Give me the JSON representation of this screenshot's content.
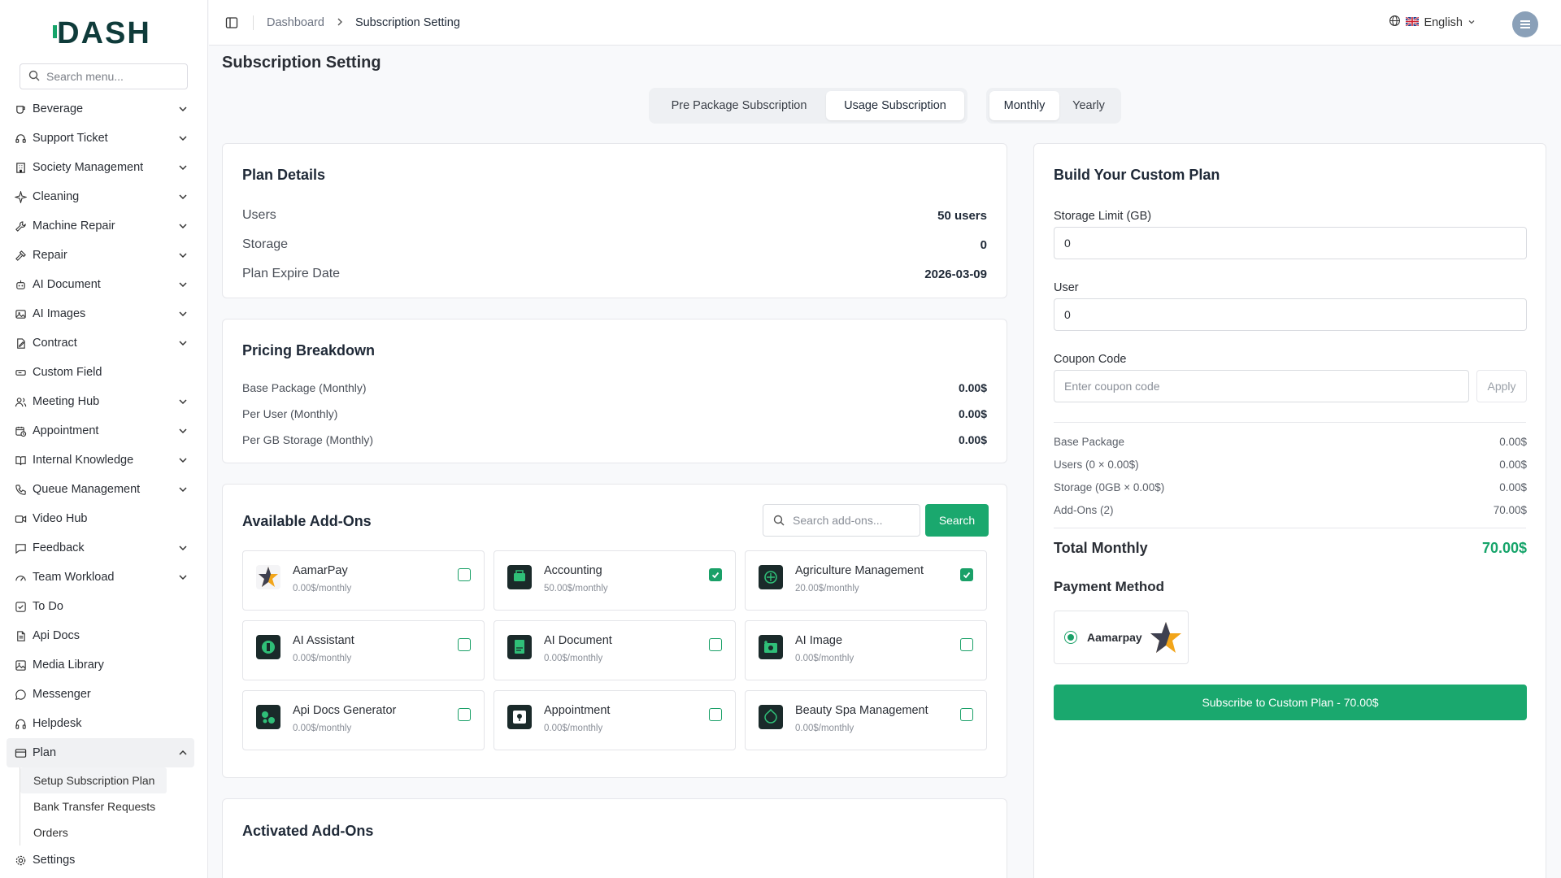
{
  "brand": {
    "logo_text": "DASH"
  },
  "sidebar": {
    "search_placeholder": "Search menu...",
    "items": [
      {
        "label": "Beverage",
        "icon": "cup-icon",
        "expandable": true
      },
      {
        "label": "Support Ticket",
        "icon": "headset-icon",
        "expandable": true
      },
      {
        "label": "Society Management",
        "icon": "building-icon",
        "expandable": true
      },
      {
        "label": "Cleaning",
        "icon": "sparkle-icon",
        "expandable": true
      },
      {
        "label": "Machine Repair",
        "icon": "wrench-icon",
        "expandable": true
      },
      {
        "label": "Repair",
        "icon": "hammer-icon",
        "expandable": true
      },
      {
        "label": "AI Document",
        "icon": "robot-icon",
        "expandable": true
      },
      {
        "label": "AI Images",
        "icon": "image-icon",
        "expandable": true
      },
      {
        "label": "Contract",
        "icon": "contract-icon",
        "expandable": true
      },
      {
        "label": "Custom Field",
        "icon": "field-icon",
        "expandable": false
      },
      {
        "label": "Meeting Hub",
        "icon": "users-icon",
        "expandable": true
      },
      {
        "label": "Appointment",
        "icon": "calendar-clock-icon",
        "expandable": true
      },
      {
        "label": "Internal Knowledge",
        "icon": "book-icon",
        "expandable": true
      },
      {
        "label": "Queue Management",
        "icon": "phone-icon",
        "expandable": true
      },
      {
        "label": "Video Hub",
        "icon": "video-icon",
        "expandable": false
      },
      {
        "label": "Feedback",
        "icon": "message-square-icon",
        "expandable": true
      },
      {
        "label": "Team Workload",
        "icon": "gauge-icon",
        "expandable": true
      },
      {
        "label": "To Do",
        "icon": "checkbox-icon",
        "expandable": false
      },
      {
        "label": "Api Docs",
        "icon": "document-icon",
        "expandable": false
      },
      {
        "label": "Media Library",
        "icon": "gallery-icon",
        "expandable": false
      },
      {
        "label": "Messenger",
        "icon": "chat-icon",
        "expandable": false
      },
      {
        "label": "Helpdesk",
        "icon": "headphones-icon",
        "expandable": false
      }
    ],
    "plan": {
      "label": "Plan",
      "icon": "credit-card-icon"
    },
    "plan_sub": [
      "Setup Subscription Plan",
      "Bank Transfer Requests",
      "Orders"
    ],
    "settings": {
      "label": "Settings",
      "icon": "gear-icon"
    }
  },
  "topbar": {
    "breadcrumb": [
      "Dashboard",
      "Subscription Setting"
    ],
    "language": "English"
  },
  "page": {
    "title": "Subscription Setting",
    "tabs": [
      "Pre Package Subscription",
      "Usage Subscription"
    ],
    "active_tab": "Usage Subscription",
    "periods": [
      "Monthly",
      "Yearly"
    ],
    "active_period": "Monthly"
  },
  "plan_details": {
    "title": "Plan Details",
    "rows": [
      {
        "label": "Users",
        "value": "50 users"
      },
      {
        "label": "Storage",
        "value": "0"
      },
      {
        "label": "Plan Expire Date",
        "value": "2026-03-09"
      }
    ]
  },
  "pricing": {
    "title": "Pricing Breakdown",
    "rows": [
      {
        "label": "Base Package (Monthly)",
        "value": "0.00$"
      },
      {
        "label": "Per User (Monthly)",
        "value": "0.00$"
      },
      {
        "label": "Per GB Storage (Monthly)",
        "value": "0.00$"
      }
    ]
  },
  "addons": {
    "title": "Available Add-Ons",
    "search_placeholder": "Search add-ons...",
    "search_button": "Search",
    "items": [
      {
        "name": "AamarPay",
        "price": "0.00$/monthly",
        "checked": false
      },
      {
        "name": "Accounting",
        "price": "50.00$/monthly",
        "checked": true
      },
      {
        "name": "Agriculture Management",
        "price": "20.00$/monthly",
        "checked": true
      },
      {
        "name": "AI Assistant",
        "price": "0.00$/monthly",
        "checked": false
      },
      {
        "name": "AI Document",
        "price": "0.00$/monthly",
        "checked": false
      },
      {
        "name": "AI Image",
        "price": "0.00$/monthly",
        "checked": false
      },
      {
        "name": "Api Docs Generator",
        "price": "0.00$/monthly",
        "checked": false
      },
      {
        "name": "Appointment",
        "price": "0.00$/monthly",
        "checked": false
      },
      {
        "name": "Beauty Spa Management",
        "price": "0.00$/monthly",
        "checked": false
      }
    ]
  },
  "activated": {
    "title": "Activated Add-Ons"
  },
  "custom_plan": {
    "title": "Build Your Custom Plan",
    "storage_label": "Storage Limit (GB)",
    "storage_value": "0",
    "user_label": "User",
    "user_value": "0",
    "coupon_label": "Coupon Code",
    "coupon_placeholder": "Enter coupon code",
    "apply_label": "Apply",
    "summary": [
      {
        "label": "Base Package",
        "value": "0.00$"
      },
      {
        "label": "Users (0 × 0.00$)",
        "value": "0.00$"
      },
      {
        "label": "Storage (0GB × 0.00$)",
        "value": "0.00$"
      },
      {
        "label": "Add-Ons (2)",
        "value": "70.00$"
      }
    ],
    "total_label": "Total Monthly",
    "total_value": "70.00$",
    "payment_title": "Payment Method",
    "payment_option": "Aamarpay",
    "subscribe_label": "Subscribe to Custom Plan - 70.00$"
  },
  "colors": {
    "accent": "#1aa86e",
    "total": "#16a46a"
  }
}
